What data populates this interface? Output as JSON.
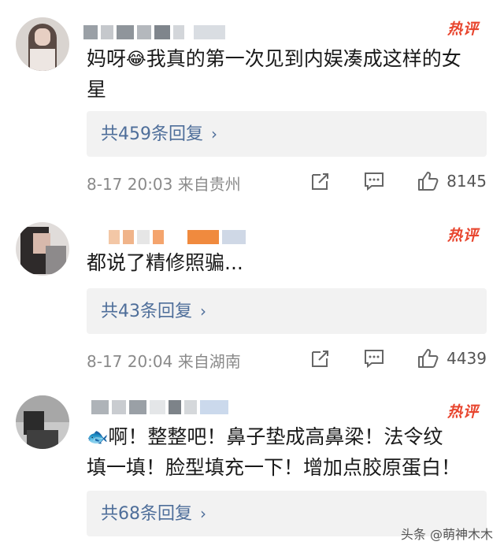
{
  "badge": "热评",
  "comments": [
    {
      "text_line1": "妈呀",
      "text_line1b": "我真的第一次见到内娱凑成这样的女",
      "text_line2": "星",
      "replies": "共459条回复",
      "meta": "8-17 20:03  来自贵州",
      "likes": "8145"
    },
    {
      "text": "都说了精修照骗...",
      "replies": "共43条回复",
      "meta": "8-17 20:04  来自湖南",
      "likes": "4439"
    },
    {
      "text_line1": "啊！整整吧！鼻子垫成高鼻梁！法令纹",
      "text_line2": "填一填！脸型填充一下！增加点胶原蛋白！",
      "replies": "共68条回复"
    }
  ],
  "chevron": "›",
  "watermark": "头条 @萌神木木",
  "icons": {
    "emoji1": "crying-face-emoji",
    "emoji3": "fish-emoji",
    "share": "share-icon",
    "comment": "comment-icon",
    "like": "thumbs-up-icon"
  }
}
